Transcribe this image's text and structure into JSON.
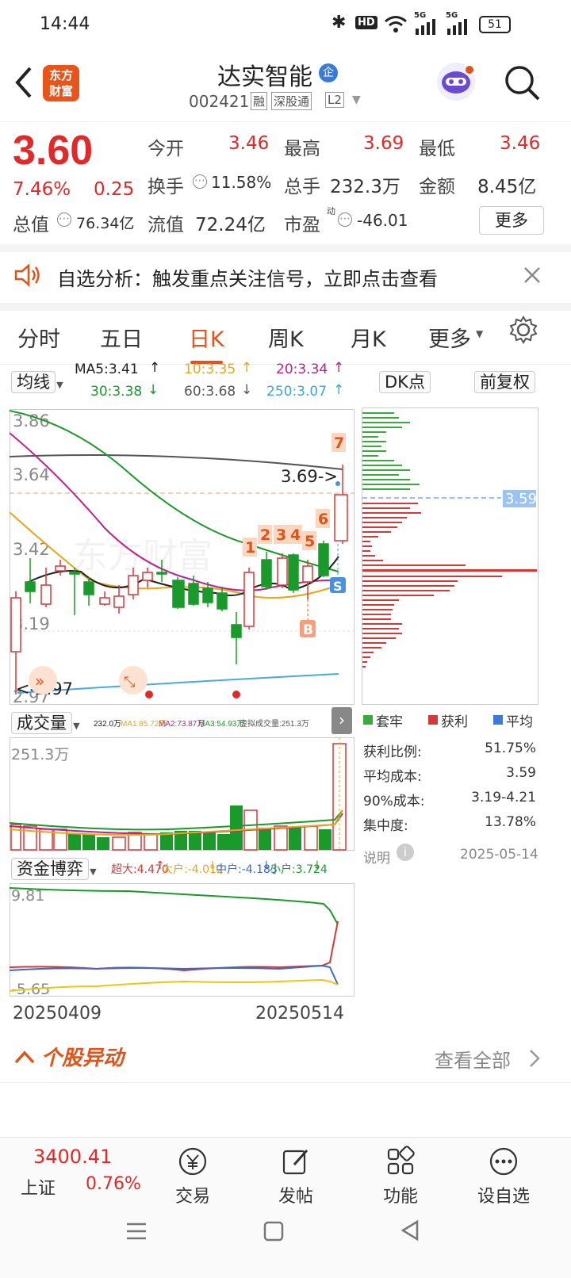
{
  "status": {
    "time": "14:44",
    "battery": "51",
    "hd": "HD",
    "net1": "5G",
    "net2": "5G"
  },
  "header": {
    "logo_line1": "东方",
    "logo_line2": "财富",
    "name": "达实智能",
    "badge": "企",
    "code": "002421",
    "tag1": "融",
    "tag2": "深股通",
    "tag3": "L2"
  },
  "quote": {
    "price": "3.60",
    "change_pct": "7.46%",
    "change": "0.25",
    "open_label": "今开",
    "open": "3.46",
    "high_label": "最高",
    "high": "3.69",
    "low_label": "最低",
    "low": "3.46",
    "turnover_label": "换手",
    "turnover": "11.58%",
    "volume_label": "总手",
    "volume": "232.3万",
    "amount_label": "金额",
    "amount": "8.45亿",
    "mktcap_label": "总值",
    "mktcap": "76.34亿",
    "float_label": "流值",
    "float": "72.24亿",
    "pe_label": "市盈",
    "pe_sup": "动",
    "pe": "-46.01",
    "more_label": "更多"
  },
  "alert": {
    "text": "自选分析：触发重点关注信号，立即点击查看"
  },
  "tabs": [
    "分时",
    "五日",
    "日K",
    "周K",
    "月K",
    "更多"
  ],
  "ma": {
    "selector": "均线",
    "ma5": "MA5:3.41",
    "ma10": "10:3.35",
    "ma20": "20:3.34",
    "ma30": "30:3.38",
    "ma60": "60:3.68",
    "ma250": "250:3.07",
    "dk": "DK点",
    "adjust": "前复权"
  },
  "kline": {
    "y_labels": [
      "3.86",
      "3.64",
      "3.42",
      "3.19",
      "2.97"
    ],
    "hi_annot": "3.69->",
    "lo_annot": "<-2.97",
    "signals": [
      "1",
      "2",
      "3",
      "4",
      "5",
      "6",
      "7"
    ],
    "b_mark": "B",
    "s_mark": "S",
    "watermark": "东方财富"
  },
  "chip": {
    "price_tag": "3.59",
    "legend": [
      "套牢",
      "获利",
      "平均"
    ],
    "colors": {
      "trapped": "#3aaa3a",
      "profit": "#d23a3a",
      "avg": "#3a7ad8"
    },
    "rows": [
      {
        "k": "获利比例:",
        "v": "51.75%"
      },
      {
        "k": "平均成本:",
        "v": "3.59"
      },
      {
        "k": "90%成本:",
        "v": "3.19-4.21"
      },
      {
        "k": "集中度:",
        "v": "13.78%"
      }
    ],
    "note": "说明",
    "date": "2025-05-14"
  },
  "volume": {
    "selector": "成交量",
    "v0": "232.0万",
    "ma1": "MA1:85.72万",
    "ma2": "MA2:73.87万",
    "ma3": "MA3:54.93万",
    "virt": "虚拟成交量:251.3万",
    "y_top": "251.3万"
  },
  "capital": {
    "selector": "资金博弈",
    "sup": "超大:4.470",
    "big": "大户:-4.012",
    "mid": "中户:-4.183",
    "small": "小户:3.724",
    "y_top": "9.81",
    "y_bot": "-5.65"
  },
  "dates": {
    "start": "20250409",
    "end": "20250514"
  },
  "movement": {
    "title": "个股异动",
    "view_all": "查看全部"
  },
  "bottom": {
    "index_value": "3400.41",
    "index_name": "上证",
    "index_change": "0.76%",
    "items": [
      "交易",
      "发帖",
      "功能",
      "设自选"
    ]
  }
}
